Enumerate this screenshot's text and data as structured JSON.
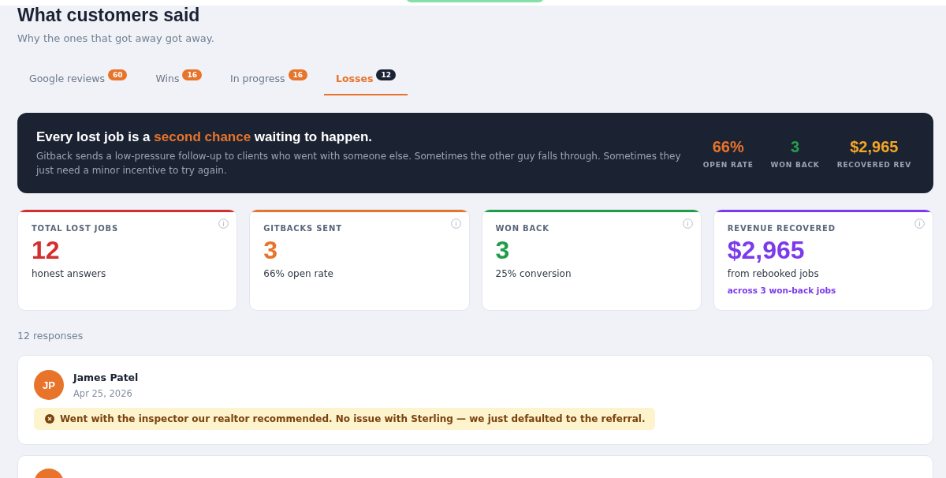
{
  "header": {
    "title": "What customers said",
    "subtitle": "Why the ones that got away got away."
  },
  "tabs": [
    {
      "label": "Google reviews",
      "count": "60",
      "selected": false
    },
    {
      "label": "Wins",
      "count": "16",
      "selected": false
    },
    {
      "label": "In progress",
      "count": "16",
      "selected": false
    },
    {
      "label": "Losses",
      "count": "12",
      "selected": true
    }
  ],
  "banner": {
    "headline_before": "Every lost job is a",
    "headline_highlight": "second chance",
    "headline_after": "waiting to happen.",
    "body": "Gitback sends a low-pressure follow-up to clients who went with someone else. Sometimes the other guy falls through. Sometimes they just need a minor incentive to try again.",
    "metrics": [
      {
        "value": "66%",
        "label": "OPEN RATE",
        "color": "#e8732a"
      },
      {
        "value": "3",
        "label": "WON BACK",
        "color": "#22a04b"
      },
      {
        "value": "$2,965",
        "label": "RECOVERED REV",
        "color": "#f5a524"
      }
    ]
  },
  "stats": [
    {
      "label": "TOTAL LOST JOBS",
      "value": "12",
      "caption": "honest answers",
      "color": "#d32f2f"
    },
    {
      "label": "GITBACKS SENT",
      "value": "3",
      "caption": "66% open rate",
      "color": "#e8732a"
    },
    {
      "label": "WON BACK",
      "value": "3",
      "caption": "25% conversion",
      "color": "#1f9d48"
    },
    {
      "label": "REVENUE RECOVERED",
      "value": "$2,965",
      "caption": "from rebooked jobs",
      "note": "across 3 won-back jobs",
      "color": "#7c3aed"
    }
  ],
  "responses_count": "12 responses",
  "responses": [
    {
      "kind": "full",
      "initials": "JP",
      "name": "James Patel",
      "date": "Apr 25, 2026",
      "reason": "Went with the inspector our realtor recommended. No issue with Sterling — we just defaulted to the referral."
    },
    {
      "kind": "partial"
    }
  ]
}
